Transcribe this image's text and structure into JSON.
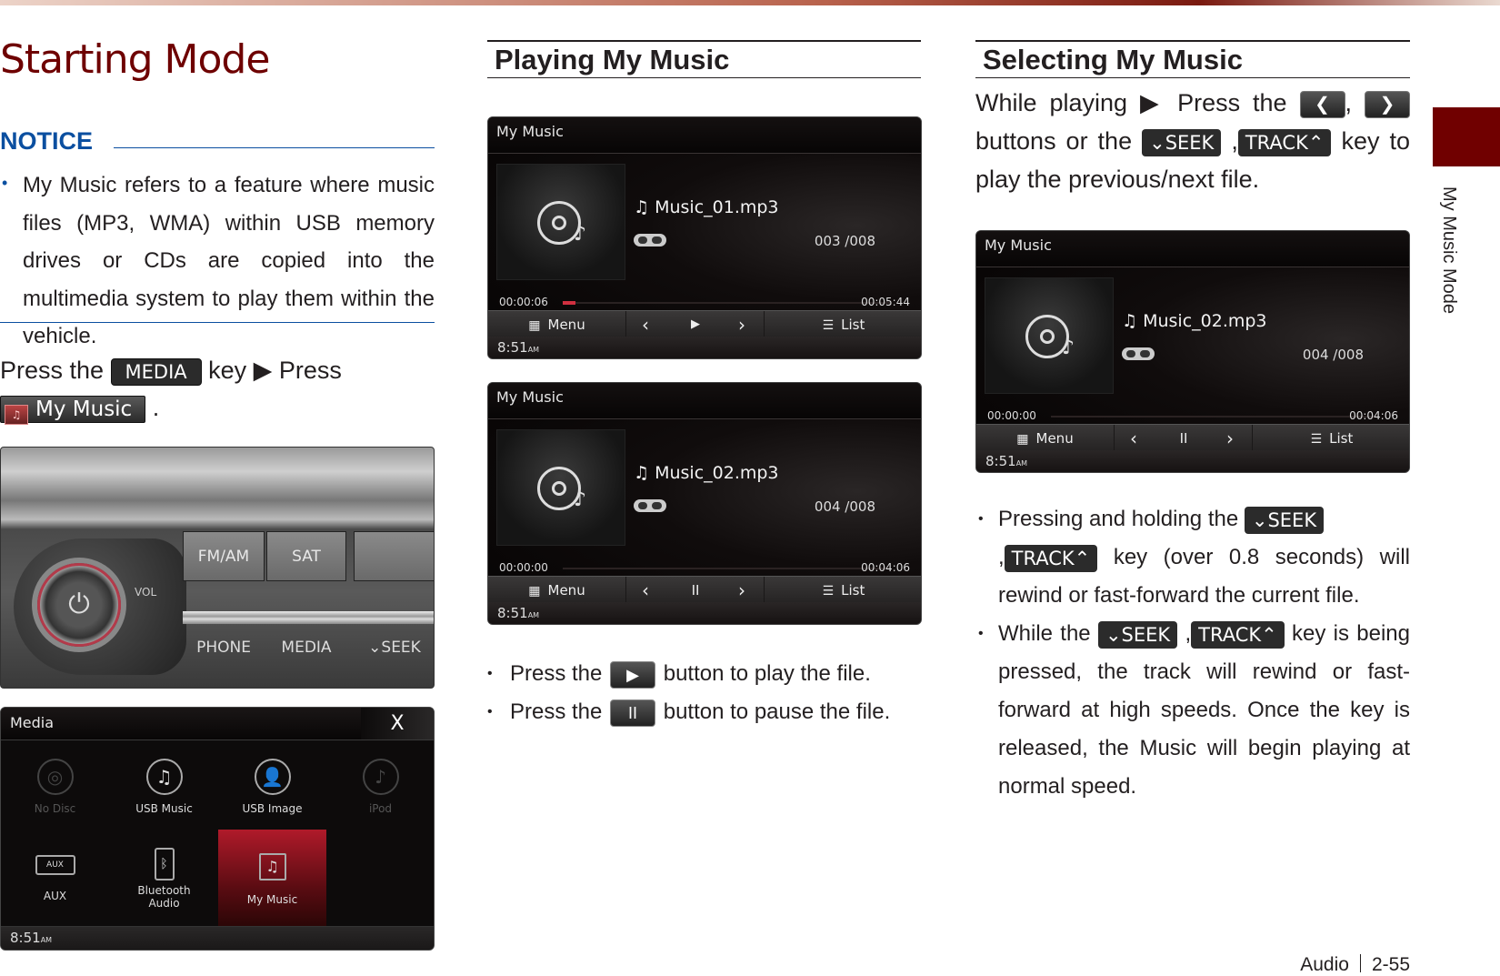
{
  "page_title": "Starting Mode",
  "side_tab_label": "My Music Mode",
  "notice": {
    "title": "NOTICE",
    "text": "My Music refers to a feature where music files (MP3, WMA) within USB memory drives or CDs are copied into the multimedia system to play them within the vehicle."
  },
  "press_instruction": {
    "part1": "Press the",
    "media_key": "MEDIA",
    "part2": "key ▶  Press",
    "my_music_button": "My Music",
    "part3": "."
  },
  "head_unit": {
    "buttons_top": [
      "FM/AM",
      "SAT"
    ],
    "buttons_bottom": [
      "PHONE",
      "MEDIA",
      "⌄SEEK"
    ],
    "vol_label": "VOL"
  },
  "media_screen": {
    "title": "Media",
    "close": "X",
    "tiles": [
      {
        "label": "No Disc",
        "state": "disabled"
      },
      {
        "label": "USB Music",
        "state": "normal"
      },
      {
        "label": "USB Image",
        "state": "normal"
      },
      {
        "label": "iPod",
        "state": "disabled"
      },
      {
        "label": "AUX",
        "state": "normal"
      },
      {
        "label": "Bluetooth Audio",
        "state": "normal"
      },
      {
        "label": "My Music",
        "state": "selected"
      }
    ],
    "clock": "8:51",
    "clock_ampm": "AM"
  },
  "playing": {
    "heading": "Playing My Music",
    "screens": [
      {
        "title": "My Music",
        "file": "Music_01.mp3",
        "count": "003 /008",
        "elapsed": "00:00:06",
        "total": "00:05:44",
        "progress": 0.02,
        "menu": "Menu",
        "list": "List",
        "play_state": "▶",
        "clock": "8:51",
        "clock_ampm": "AM"
      },
      {
        "title": "My Music",
        "file": "Music_02.mp3",
        "count": "004 /008",
        "elapsed": "00:00:00",
        "total": "00:04:06",
        "progress": 0,
        "menu": "Menu",
        "list": "List",
        "play_state": "II",
        "clock": "8:51",
        "clock_ampm": "AM"
      }
    ],
    "bullets": [
      {
        "pre": "Press the",
        "button": "▶",
        "post": "button to play the file."
      },
      {
        "pre": "Press the",
        "button": "II",
        "post": "button to pause the file."
      }
    ]
  },
  "selecting": {
    "heading": "Selecting My Music",
    "intro": {
      "p1": "While playing ▶  Press the",
      "prev": "❮",
      "comma1": ",",
      "next": "❯",
      "p2": "buttons or the",
      "seek": "⌄SEEK",
      "comma2": ",",
      "track": "TRACK⌃",
      "p3": "key to play the previous/next file."
    },
    "screen": {
      "title": "My Music",
      "file": "Music_02.mp3",
      "count": "004 /008",
      "elapsed": "00:00:00",
      "total": "00:04:06",
      "progress": 0,
      "menu": "Menu",
      "list": "List",
      "play_state": "II",
      "clock": "8:51",
      "clock_ampm": "AM"
    },
    "bullets": [
      {
        "p1": "Pressing and holding the",
        "seek": "⌄SEEK",
        "comma": ",",
        "track": "TRACK⌃",
        "p2": "key (over 0.8 seconds) will rewind or fast-forward the current file."
      },
      {
        "p1": "While the",
        "seek": "⌄SEEK",
        "comma": ",",
        "track": "TRACK⌃",
        "p2": "key is being pressed, the track will rewind or fast-forward at high speeds. Once the key is released, the Music will begin playing at normal speed."
      }
    ]
  },
  "footer": {
    "section": "Audio",
    "page": "2-55"
  }
}
